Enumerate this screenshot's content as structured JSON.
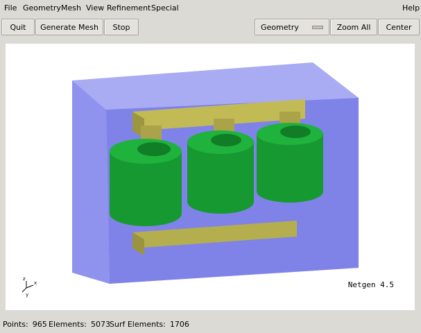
{
  "menu": {
    "file": "File",
    "geometry": "Geometry",
    "mesh": "Mesh",
    "view": "View",
    "refinement": "Refinement",
    "special": "Special",
    "help": "Help"
  },
  "toolbar": {
    "quit": "Quit",
    "generate_mesh": "Generate Mesh",
    "stop": "Stop",
    "mode_select": "Geometry",
    "zoom_all": "Zoom All",
    "center": "Center"
  },
  "viewport": {
    "watermark": "Netgen 4.5",
    "axis_labels": {
      "x": "x",
      "y": "y",
      "z": "z"
    },
    "colors": {
      "domain_box": "#8a8ff0",
      "core": "#b5ae4e",
      "coil": "#1fa33a"
    }
  },
  "status": {
    "points_label": "Points:",
    "points_value": "965",
    "elements_label": "Elements:",
    "elements_value": "5073",
    "surf_label": "Surf Elements:",
    "surf_value": "1706"
  }
}
